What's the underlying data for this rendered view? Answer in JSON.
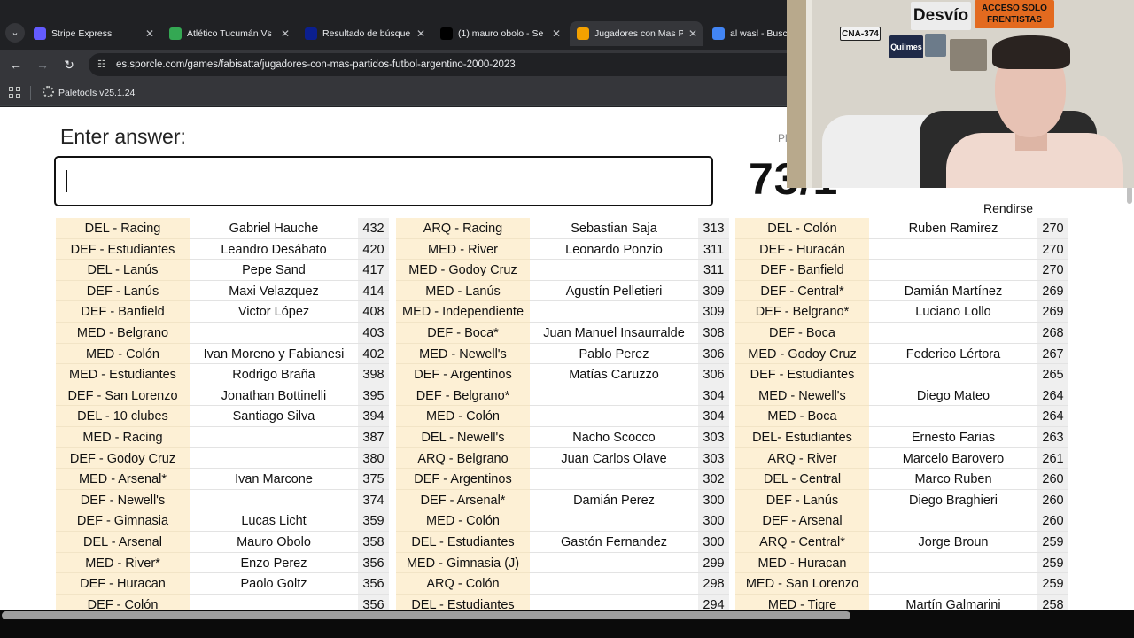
{
  "browser": {
    "tabs": [
      {
        "label": "Stripe Express",
        "color": "#635bff"
      },
      {
        "label": "Atlético Tucumán Vs",
        "color": "#34a853"
      },
      {
        "label": "Resultado de búsque",
        "color": "#0b1f8f"
      },
      {
        "label": "(1) mauro obolo - Se",
        "color": "#000000"
      },
      {
        "label": "Jugadores con Mas P",
        "color": "#f4a100"
      },
      {
        "label": "al wasl - Buscar",
        "color": "#4285f4"
      }
    ],
    "url": "es.sporcle.com/games/fabisatta/jugadores-con-mas-partidos-futbol-argentino-2000-2023",
    "bookmark": "Paletools v25.1.24"
  },
  "quiz": {
    "enter_label": "Enter answer:",
    "score_label": "Pl",
    "score": "73/1",
    "give_up": "Rendirse",
    "columns": [
      [
        {
          "cat": "DEL - Racing",
          "name": "Gabriel Hauche",
          "num": "432"
        },
        {
          "cat": "DEF - Estudiantes",
          "name": "Leandro Desábato",
          "num": "420"
        },
        {
          "cat": "DEL - Lanús",
          "name": "Pepe Sand",
          "num": "417"
        },
        {
          "cat": "DEF - Lanús",
          "name": "Maxi Velazquez",
          "num": "414"
        },
        {
          "cat": "DEF - Banfield",
          "name": "Victor López",
          "num": "408"
        },
        {
          "cat": "MED - Belgrano",
          "name": "",
          "num": "403"
        },
        {
          "cat": "MED - Colón",
          "name": "Ivan Moreno y Fabianesi",
          "num": "402"
        },
        {
          "cat": "MED - Estudiantes",
          "name": "Rodrigo Braña",
          "num": "398"
        },
        {
          "cat": "DEF - San Lorenzo",
          "name": "Jonathan Bottinelli",
          "num": "395"
        },
        {
          "cat": "DEL - 10 clubes",
          "name": "Santiago Silva",
          "num": "394"
        },
        {
          "cat": "MED - Racing",
          "name": "",
          "num": "387"
        },
        {
          "cat": "DEF - Godoy Cruz",
          "name": "",
          "num": "380"
        },
        {
          "cat": "MED - Arsenal*",
          "name": "Ivan Marcone",
          "num": "375"
        },
        {
          "cat": "DEF - Newell's",
          "name": "",
          "num": "374"
        },
        {
          "cat": "DEF - Gimnasia",
          "name": "Lucas Licht",
          "num": "359"
        },
        {
          "cat": "DEL - Arsenal",
          "name": "Mauro Obolo",
          "num": "358"
        },
        {
          "cat": "MED - River*",
          "name": "Enzo Perez",
          "num": "356"
        },
        {
          "cat": "DEF - Huracan",
          "name": "Paolo Goltz",
          "num": "356"
        },
        {
          "cat": "DEF - Colón",
          "name": "",
          "num": "356"
        }
      ],
      [
        {
          "cat": "ARQ - Racing",
          "name": "Sebastian Saja",
          "num": "313"
        },
        {
          "cat": "MED - River",
          "name": "Leonardo Ponzio",
          "num": "311"
        },
        {
          "cat": "MED - Godoy Cruz",
          "name": "",
          "num": "311"
        },
        {
          "cat": "MED - Lanús",
          "name": "Agustín Pelletieri",
          "num": "309"
        },
        {
          "cat": "MED - Independiente",
          "name": "",
          "num": "309"
        },
        {
          "cat": "DEF - Boca*",
          "name": "Juan Manuel Insaurralde",
          "num": "308"
        },
        {
          "cat": "MED - Newell's",
          "name": "Pablo Perez",
          "num": "306"
        },
        {
          "cat": "DEF - Argentinos",
          "name": "Matías Caruzzo",
          "num": "306"
        },
        {
          "cat": "DEF - Belgrano*",
          "name": "",
          "num": "304"
        },
        {
          "cat": "MED - Colón",
          "name": "",
          "num": "304"
        },
        {
          "cat": "DEL - Newell's",
          "name": "Nacho Scocco",
          "num": "303"
        },
        {
          "cat": "ARQ - Belgrano",
          "name": "Juan Carlos Olave",
          "num": "303"
        },
        {
          "cat": "DEF - Argentinos",
          "name": "",
          "num": "302"
        },
        {
          "cat": "DEF - Arsenal*",
          "name": "Damián Perez",
          "num": "300"
        },
        {
          "cat": "MED - Colón",
          "name": "",
          "num": "300"
        },
        {
          "cat": "DEL - Estudiantes",
          "name": "Gastón Fernandez",
          "num": "300"
        },
        {
          "cat": "MED - Gimnasia (J)",
          "name": "",
          "num": "299"
        },
        {
          "cat": "ARQ - Colón",
          "name": "",
          "num": "298"
        },
        {
          "cat": "DEL - Estudiantes",
          "name": "",
          "num": "294"
        }
      ],
      [
        {
          "cat": "DEL - Colón",
          "name": "Ruben Ramirez",
          "num": "270"
        },
        {
          "cat": "DEF - Huracán",
          "name": "",
          "num": "270"
        },
        {
          "cat": "DEF - Banfield",
          "name": "",
          "num": "270"
        },
        {
          "cat": "DEF - Central*",
          "name": "Damián Martínez",
          "num": "269"
        },
        {
          "cat": "DEF - Belgrano*",
          "name": "Luciano Lollo",
          "num": "269"
        },
        {
          "cat": "DEF - Boca",
          "name": "",
          "num": "268"
        },
        {
          "cat": "MED - Godoy Cruz",
          "name": "Federico Lértora",
          "num": "267"
        },
        {
          "cat": "DEF - Estudiantes",
          "name": "",
          "num": "265"
        },
        {
          "cat": "MED - Newell's",
          "name": "Diego Mateo",
          "num": "264"
        },
        {
          "cat": "MED - Boca",
          "name": "",
          "num": "264"
        },
        {
          "cat": "DEL- Estudiantes",
          "name": "Ernesto Farias",
          "num": "263"
        },
        {
          "cat": "ARQ - River",
          "name": "Marcelo Barovero",
          "num": "261"
        },
        {
          "cat": "DEL - Central",
          "name": "Marco Ruben",
          "num": "260"
        },
        {
          "cat": "DEF - Lanús",
          "name": "Diego Braghieri",
          "num": "260"
        },
        {
          "cat": "DEF - Arsenal",
          "name": "",
          "num": "260"
        },
        {
          "cat": "ARQ - Central*",
          "name": "Jorge Broun",
          "num": "259"
        },
        {
          "cat": "MED - Huracan",
          "name": "",
          "num": "259"
        },
        {
          "cat": "MED - San Lorenzo",
          "name": "",
          "num": "259"
        },
        {
          "cat": "MED - Tigre",
          "name": "Martín Galmarini",
          "num": "258"
        }
      ]
    ]
  },
  "webcam": {
    "stickers": [
      "Desvío",
      "ACCESO SOLO FRENTISTAS",
      "CNA-374",
      "Quilmes"
    ]
  }
}
